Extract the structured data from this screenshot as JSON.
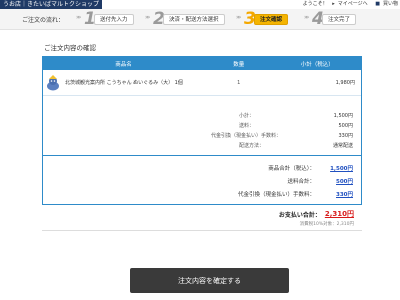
{
  "header": {
    "shop_name": "うお店｜きたいばマルトクショップ",
    "welcome": "ようこそ！",
    "mypage": "マイページへ",
    "cart": "買い物"
  },
  "steps": {
    "flow_label": "ご注文の流れ：",
    "items": [
      {
        "num": "1",
        "label": "送付先入力"
      },
      {
        "num": "2",
        "label": "決済・配送方法選択"
      },
      {
        "num": "3",
        "label": "注文確認"
      },
      {
        "num": "4",
        "label": "注文完了"
      }
    ],
    "active_index": 2
  },
  "section_title": "ご注文内容の確認",
  "table": {
    "col_name": "商品名",
    "col_qty": "数量",
    "col_subtotal": "小計（税込）",
    "rows": [
      {
        "name": "北茨城観光案内所 こうちゃん ぬいぐるみ（大） 1個",
        "qty": "1",
        "subtotal": "1,980円"
      }
    ],
    "summary": [
      {
        "label": "小計：",
        "value": "1,500円"
      },
      {
        "label": "送料：",
        "value": "500円"
      },
      {
        "label": "代金引換（現金払い）手数料：",
        "value": "330円"
      },
      {
        "label": "配送方法：",
        "value": "通常配送"
      }
    ]
  },
  "totals": {
    "lines": [
      {
        "label": "商品合計（税込）：",
        "value": "1,500円"
      },
      {
        "label": "送料合計：",
        "value": "500円"
      },
      {
        "label": "代金引換（現金払い）手数料：",
        "value": "330円"
      }
    ]
  },
  "payment": {
    "label": "お支払い合計：",
    "value": "2,310円",
    "tax_note": "消費税10%対象：2,310円"
  },
  "confirm_button": "注文内容を確定する",
  "colors": {
    "accent": "#2e8bc9",
    "active_step": "#f4b400",
    "total_red": "#d81b1b",
    "button": "#3a3a3a"
  }
}
